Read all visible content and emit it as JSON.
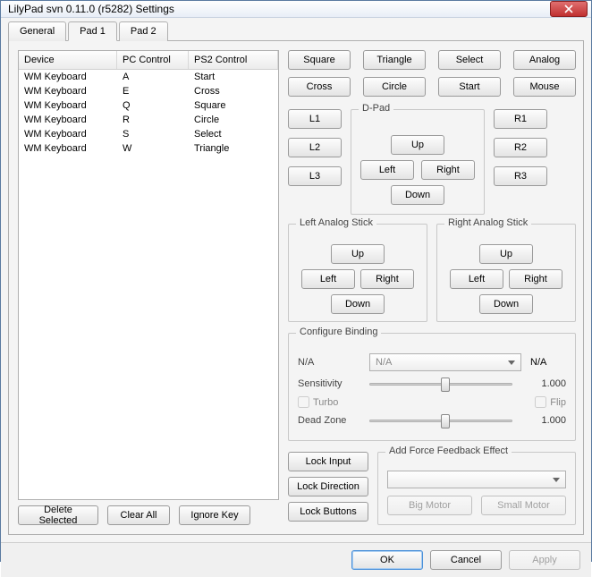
{
  "window": {
    "title": "LilyPad svn 0.11.0 (r5282) Settings"
  },
  "tabs": {
    "general": "General",
    "pad1": "Pad 1",
    "pad2": "Pad 2"
  },
  "list": {
    "headers": {
      "device": "Device",
      "pc": "PC Control",
      "ps2": "PS2 Control"
    },
    "rows": [
      {
        "device": "WM Keyboard",
        "pc": "A",
        "ps2": "Start"
      },
      {
        "device": "WM Keyboard",
        "pc": "E",
        "ps2": "Cross"
      },
      {
        "device": "WM Keyboard",
        "pc": "Q",
        "ps2": "Square"
      },
      {
        "device": "WM Keyboard",
        "pc": "R",
        "ps2": "Circle"
      },
      {
        "device": "WM Keyboard",
        "pc": "S",
        "ps2": "Select"
      },
      {
        "device": "WM Keyboard",
        "pc": "W",
        "ps2": "Triangle"
      }
    ]
  },
  "left_buttons": {
    "delete": "Delete Selected",
    "clear": "Clear All",
    "ignore": "Ignore Key"
  },
  "face": {
    "square": "Square",
    "triangle": "Triangle",
    "cross": "Cross",
    "circle": "Circle"
  },
  "sys": {
    "select": "Select",
    "start": "Start",
    "analog": "Analog",
    "mouse": "Mouse"
  },
  "shoulders": {
    "l1": "L1",
    "l2": "L2",
    "l3": "L3",
    "r1": "R1",
    "r2": "R2",
    "r3": "R3"
  },
  "dpad": {
    "title": "D-Pad",
    "up": "Up",
    "down": "Down",
    "left": "Left",
    "right": "Right"
  },
  "analog_left": {
    "title": "Left Analog Stick",
    "up": "Up",
    "down": "Down",
    "left": "Left",
    "right": "Right"
  },
  "analog_right": {
    "title": "Right Analog Stick",
    "up": "Up",
    "down": "Down",
    "left": "Left",
    "right": "Right"
  },
  "config": {
    "title": "Configure Binding",
    "na1": "N/A",
    "combo": "N/A",
    "na2": "N/A",
    "sensitivity_label": "Sensitivity",
    "sensitivity_val": "1.000",
    "turbo": "Turbo",
    "flip": "Flip",
    "deadzone_label": "Dead Zone",
    "deadzone_val": "1.000"
  },
  "locks": {
    "input": "Lock Input",
    "direction": "Lock Direction",
    "buttons": "Lock Buttons"
  },
  "ff": {
    "title": "Add Force Feedback Effect",
    "big": "Big Motor",
    "small": "Small Motor",
    "combo": ""
  },
  "dialog": {
    "ok": "OK",
    "cancel": "Cancel",
    "apply": "Apply"
  }
}
